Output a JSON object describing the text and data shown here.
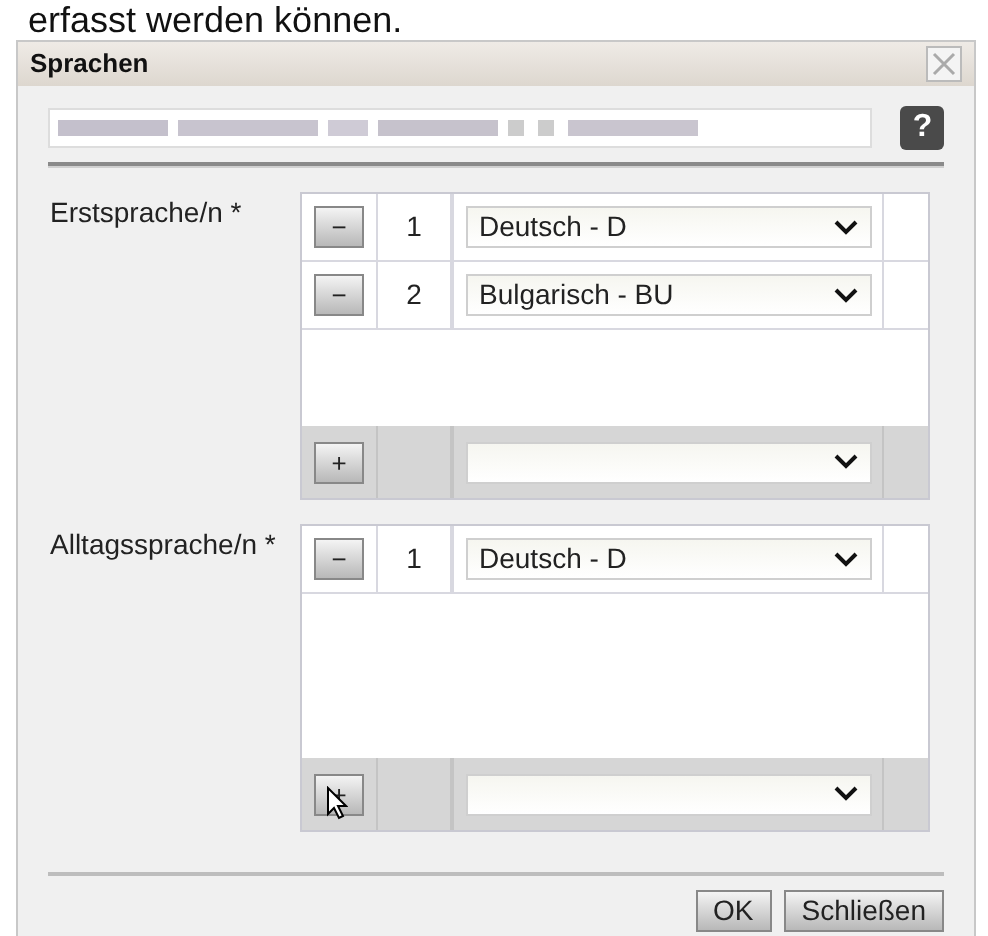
{
  "background_text": "erfasst werden können.",
  "window": {
    "title": "Sprachen"
  },
  "help_button": "?",
  "sections": [
    {
      "label": "Erstsprache/n *",
      "rows": [
        {
          "remove": "−",
          "number": "1",
          "value": "Deutsch - D"
        },
        {
          "remove": "−",
          "number": "2",
          "value": "Bulgarisch - BU"
        }
      ],
      "add": "+"
    },
    {
      "label": "Alltagssprache/n *",
      "rows": [
        {
          "remove": "−",
          "number": "1",
          "value": "Deutsch - D"
        }
      ],
      "add": "+"
    }
  ],
  "buttons": [
    "OK",
    "Schließen"
  ]
}
